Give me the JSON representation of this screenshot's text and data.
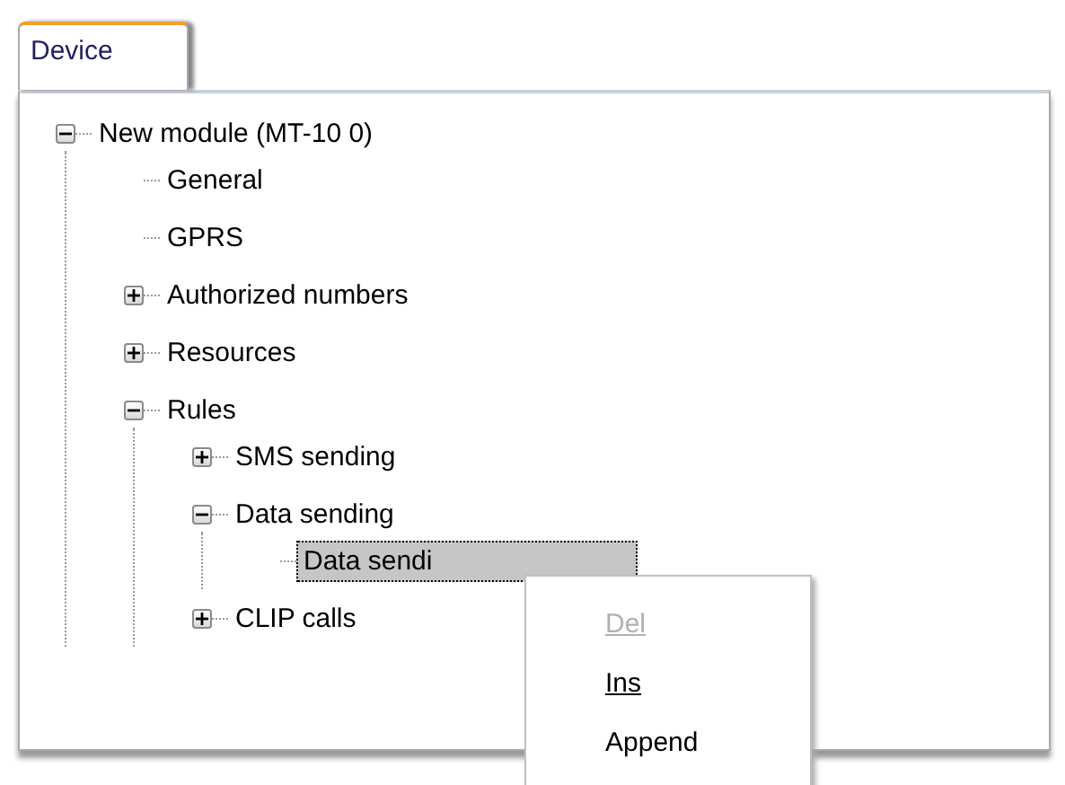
{
  "tabs": [
    {
      "label": "Device",
      "selected": true
    }
  ],
  "tree": [
    {
      "label": "New module  (MT-10 0)",
      "expanded": true,
      "selected": false,
      "children": [
        {
          "label": "General",
          "selected": false
        },
        {
          "label": "GPRS",
          "selected": false
        },
        {
          "label": "Authorized numbers",
          "expanded": false,
          "selected": false
        },
        {
          "label": "Resources",
          "expanded": false,
          "selected": false
        },
        {
          "label": "Rules",
          "expanded": true,
          "selected": false,
          "children": [
            {
              "label": "SMS sending",
              "expanded": false,
              "selected": false
            },
            {
              "label": "Data sending",
              "expanded": true,
              "selected": false,
              "children": [
                {
                  "label": "Data sendi",
                  "selected": true
                }
              ]
            },
            {
              "label": "CLIP calls",
              "expanded": false,
              "selected": false
            }
          ]
        }
      ]
    }
  ],
  "context_menu": [
    {
      "label": "Del",
      "disabled": true,
      "underlined": true
    },
    {
      "label": "Ins",
      "disabled": false,
      "underlined": true
    },
    {
      "label": "Append",
      "disabled": false,
      "underlined": false
    }
  ]
}
